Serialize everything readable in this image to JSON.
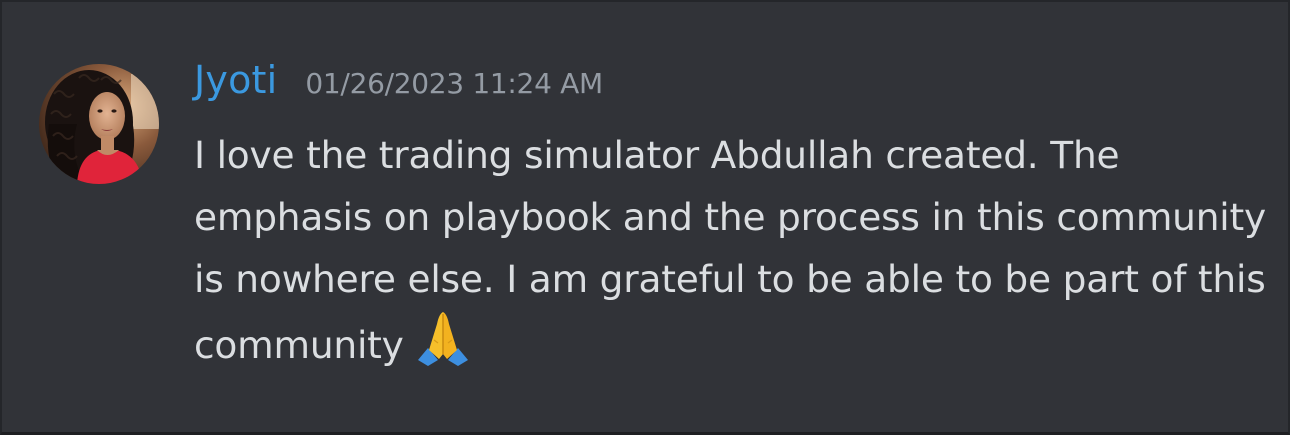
{
  "message": {
    "author": {
      "name": "Jyoti",
      "name_color": "#3b99e0",
      "avatar": "user-avatar"
    },
    "timestamp": "01/26/2023 11:24 AM",
    "text": "I love the trading simulator Abdullah created. The emphasis on playbook and the process in this community is nowhere else. I am grateful to be able to be part of this community",
    "emoji": "folded-hands-icon"
  },
  "colors": {
    "background": "#313338",
    "text": "#dbdee1",
    "timestamp": "#949ba4"
  }
}
